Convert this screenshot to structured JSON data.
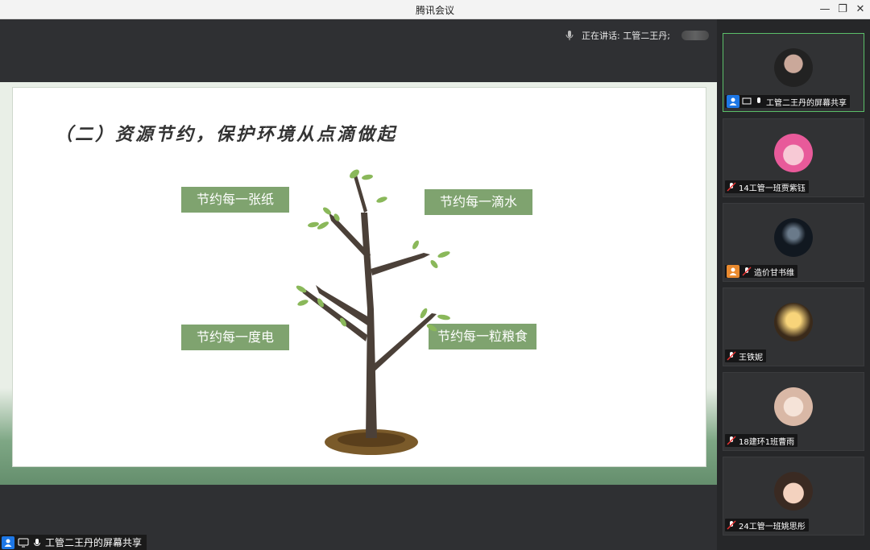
{
  "window": {
    "title": "腾讯会议"
  },
  "stage": {
    "speaking_text": "正在讲话: 工管二王丹;"
  },
  "slide": {
    "title": "（二）资源节约，保护环境从点滴做起",
    "labels": {
      "paper": "节约每一张纸",
      "water": "节约每一滴水",
      "electricity": "节约每一度电",
      "grain": "节约每一粒粮食"
    },
    "accent": "#7fa36f"
  },
  "share_bar": {
    "label": "工管二王丹的屏幕共享"
  },
  "participants": [
    {
      "name": "工管二王丹的屏幕共享",
      "avatar": "portrait-avatar",
      "active": true,
      "badge": "blue"
    },
    {
      "name": "14工管一班贾紫钰",
      "avatar": "pink-cartoon-avatar",
      "active": false,
      "badge": ""
    },
    {
      "name": "造价甘书维",
      "avatar": "dark-figure-avatar",
      "active": false,
      "badge": "orange"
    },
    {
      "name": "王铁妮",
      "avatar": "sunset-avatar",
      "active": false,
      "badge": ""
    },
    {
      "name": "18建环1班曹雨",
      "avatar": "anime-avatar",
      "active": false,
      "badge": ""
    },
    {
      "name": "24工管一班姚思彤",
      "avatar": "child-avatar",
      "active": false,
      "badge": ""
    }
  ],
  "colors": {
    "active_border": "#5bbf69",
    "blue_badge": "#1d77e6",
    "orange_badge": "#e98a2f"
  }
}
